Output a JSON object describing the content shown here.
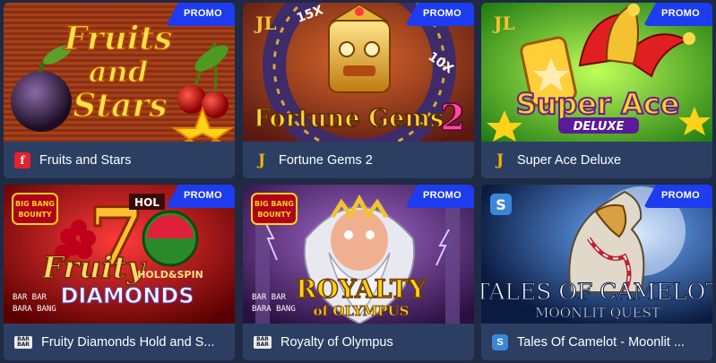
{
  "promo_label": "PROMO",
  "games": [
    {
      "title": "Fruits and Stars",
      "provider_badge": "f",
      "art_text": [
        "Fruits",
        "and",
        "Stars"
      ]
    },
    {
      "title": "Fortune Gems 2",
      "provider_badge": "J",
      "art_text": [
        "JL",
        "Fortune Gems",
        "2",
        "15X",
        "10X"
      ]
    },
    {
      "title": "Super Ace Deluxe",
      "provider_badge": "J",
      "art_text": [
        "JL",
        "Super Ace",
        "DELUXE"
      ]
    },
    {
      "title": "Fruity Diamonds Hold and S...",
      "provider_badge": "BAR BAR",
      "art_text": [
        "BIG BANG BOUNTY",
        "7",
        "Fruity",
        "HOLD&SPIN",
        "DIAMONDS",
        "HOL",
        "BAR BARA BANG"
      ]
    },
    {
      "title": "Royalty of Olympus",
      "provider_badge": "BAR BAR",
      "art_text": [
        "BIG BANG BOUNTY",
        "ROYALTY",
        "of OLYMPUS",
        "BAR BARA BANG"
      ]
    },
    {
      "title": "Tales Of Camelot - Moonlit ...",
      "provider_badge": "S",
      "art_text": [
        "S",
        "TALES OF CAMELOT",
        "MOONLIT QUEST"
      ]
    }
  ],
  "colors": {
    "page_bg": "#1f2a44",
    "card_footer": "#2c3f63",
    "promo_bg": "#1d3cf0"
  }
}
